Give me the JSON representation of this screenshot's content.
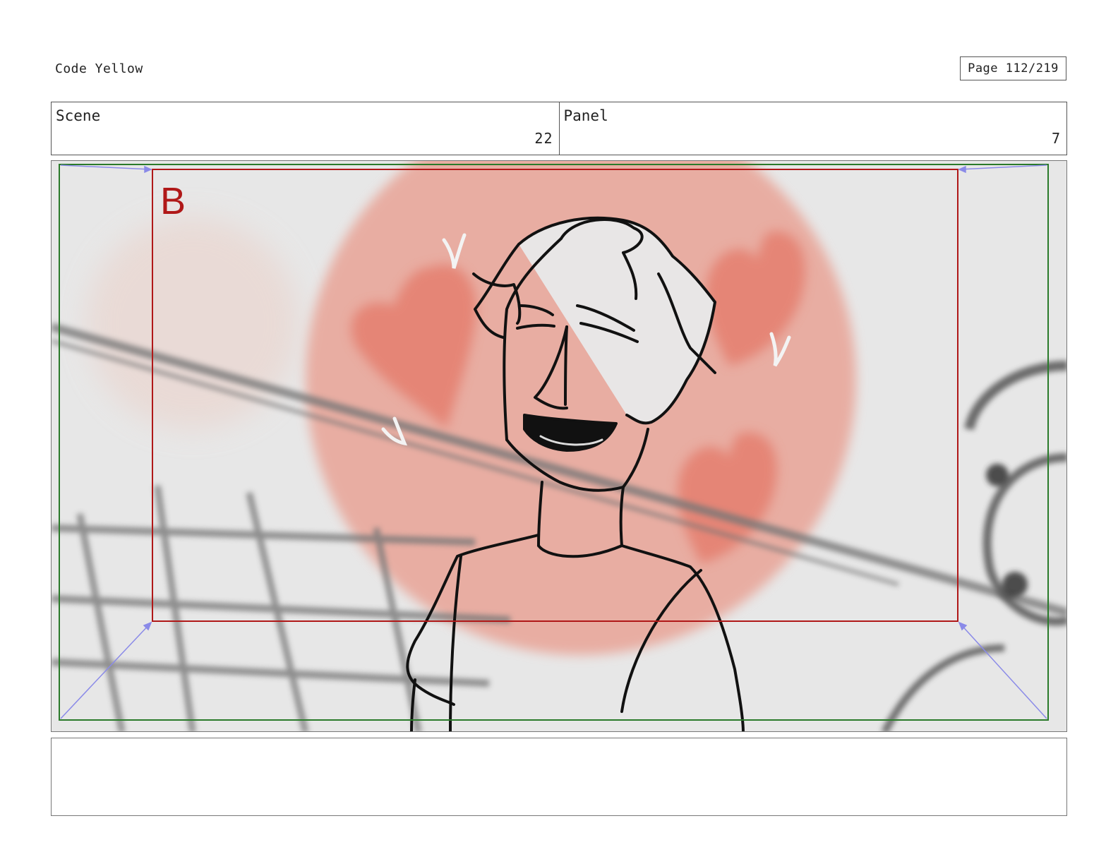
{
  "header": {
    "title": "Code Yellow",
    "page": "Page 112/219"
  },
  "info": {
    "scene_label": "Scene",
    "scene_value": "22",
    "panel_label": "Panel",
    "panel_value": "7"
  },
  "frame": {
    "marker": "B"
  },
  "colors": {
    "frame_red": "#b01818",
    "safe_green": "#2a7a2a",
    "arrow_blue": "#8a8ae8",
    "bg_circle": "#e98f7e"
  },
  "notes": {
    "text": ""
  }
}
